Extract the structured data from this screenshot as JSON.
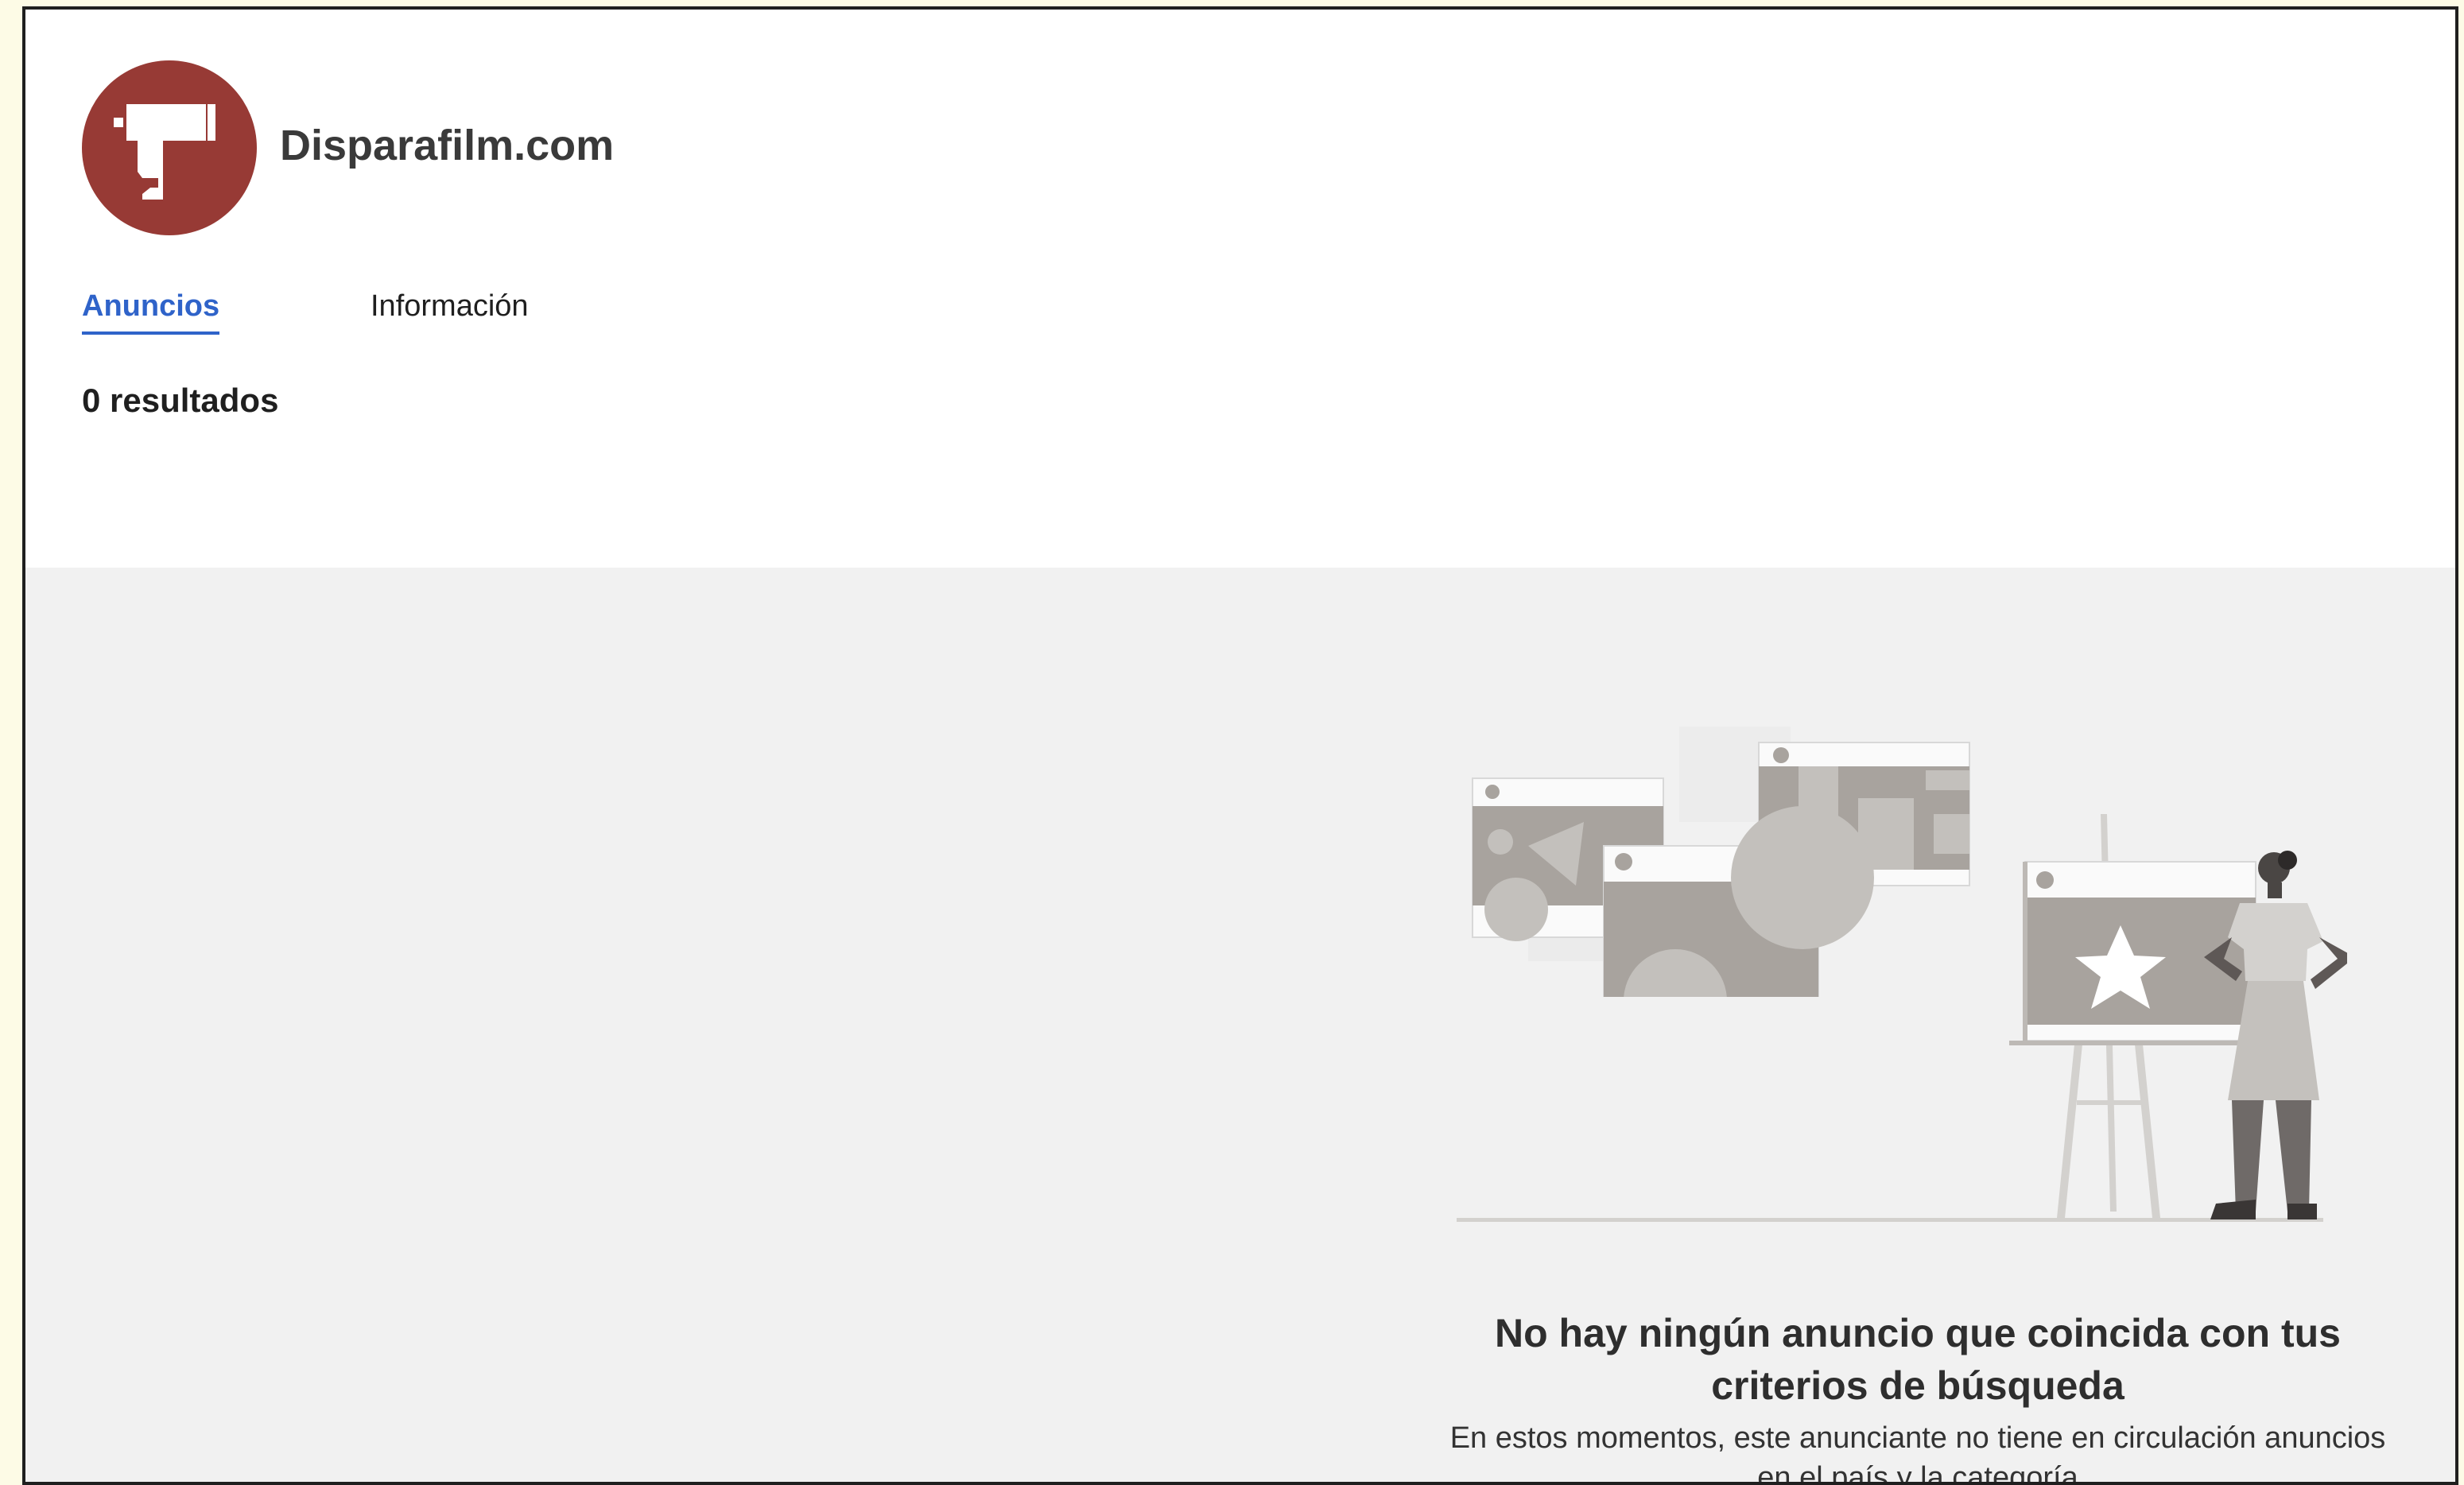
{
  "advertiser": {
    "name": "Disparafilm.com",
    "logo_icon": "film-camera-icon",
    "logo_color": "#973a35"
  },
  "tabs": [
    {
      "label": "Anuncios",
      "active": true
    },
    {
      "label": "Información",
      "active": false
    }
  ],
  "results": {
    "label": "0 resultados"
  },
  "empty_state": {
    "illustration": "empty-ads-illustration",
    "title": "No hay ningún anuncio que coincida con tus criterios de búsqueda",
    "description": "En estos momentos, este anunciante no tiene en circulación anuncios en el país y la categoría"
  },
  "colors": {
    "accent": "#2f63c9",
    "content_bg": "#f1f1f1",
    "page_border": "#1f1f1f"
  }
}
